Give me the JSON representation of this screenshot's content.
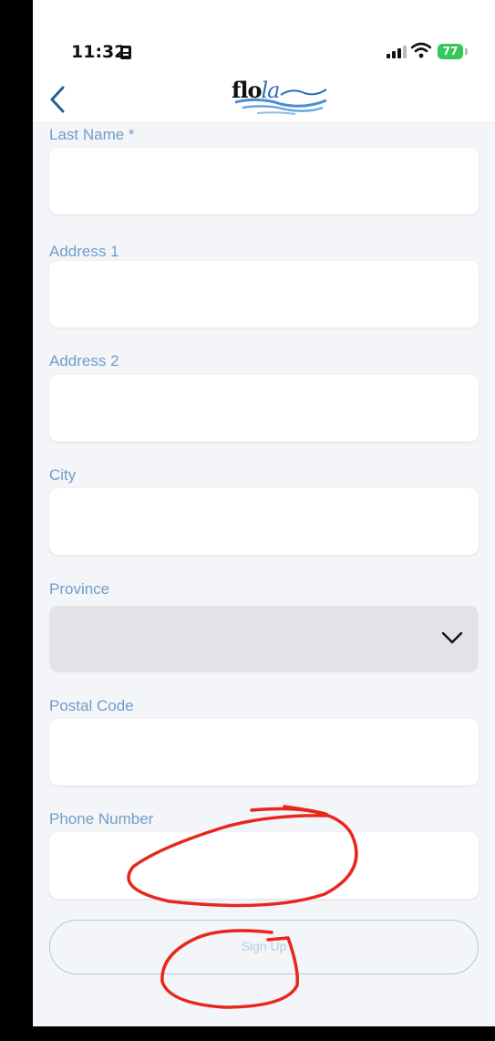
{
  "status_bar": {
    "time": "11:32",
    "battery": "77"
  },
  "header": {
    "logo_main": "flo",
    "logo_accent": "la"
  },
  "form": {
    "fields": [
      {
        "label": "Last Name *",
        "value": ""
      },
      {
        "label": "Address 1",
        "value": ""
      },
      {
        "label": "Address 2",
        "value": ""
      },
      {
        "label": "City",
        "value": ""
      },
      {
        "label": "Province",
        "value": ""
      },
      {
        "label": "Postal Code",
        "value": ""
      },
      {
        "label": "Phone Number",
        "value": ""
      }
    ],
    "submit_label": "Sign Up"
  },
  "colors": {
    "label": "#6f9ec9",
    "annotation": "#e8261c",
    "battery": "#34c759",
    "brand_blue": "#2f6fb3"
  }
}
